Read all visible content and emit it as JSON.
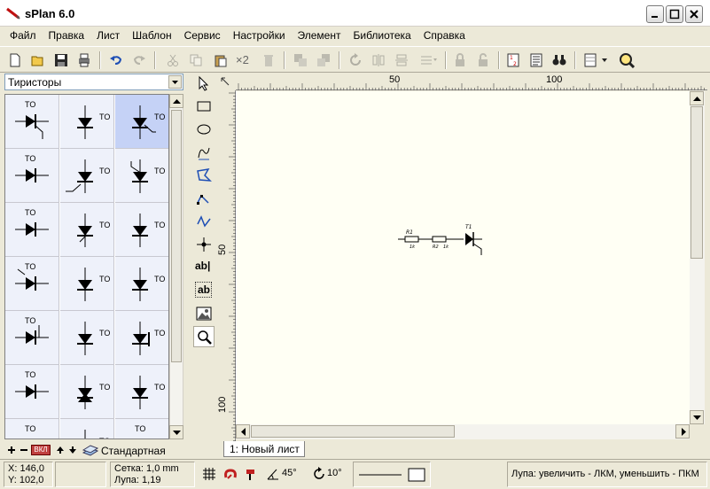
{
  "window": {
    "title": "sPlan 6.0"
  },
  "menu": [
    "Файл",
    "Правка",
    "Лист",
    "Шаблон",
    "Сервис",
    "Настройки",
    "Элемент",
    "Библиотека",
    "Справка"
  ],
  "toolbar": {
    "dup_label": "×2"
  },
  "library": {
    "selected_category": "Тиристоры",
    "symbol_label": "TO",
    "footer_label": "Стандартная",
    "footer_badge": "ВКЛ"
  },
  "tools": {
    "text_label": "ab|",
    "textbox_label": "ab"
  },
  "rulers": {
    "top": [
      "50",
      "100"
    ],
    "left": [
      "50",
      "100"
    ]
  },
  "schematic": {
    "r1_name": "R1",
    "r1_value": "1k",
    "r2_name": "R2",
    "r2_value": "1k",
    "t1_name": "T1"
  },
  "sheet_tab": "1: Новый лист",
  "status": {
    "x": "X: 146,0",
    "y": "Y: 102,0",
    "grid": "Сетка:  1,0 mm",
    "zoom": "Лупа:  1,19",
    "angle1": "45°",
    "angle2": "10°",
    "hint": "Лупа: увеличить - ЛКМ, уменьшить - ПКМ"
  },
  "colors": {
    "accent": "#316ac5",
    "canvas": "#fffff4",
    "selected_cell": "#c5d2f6",
    "cell": "#eef1fa"
  }
}
